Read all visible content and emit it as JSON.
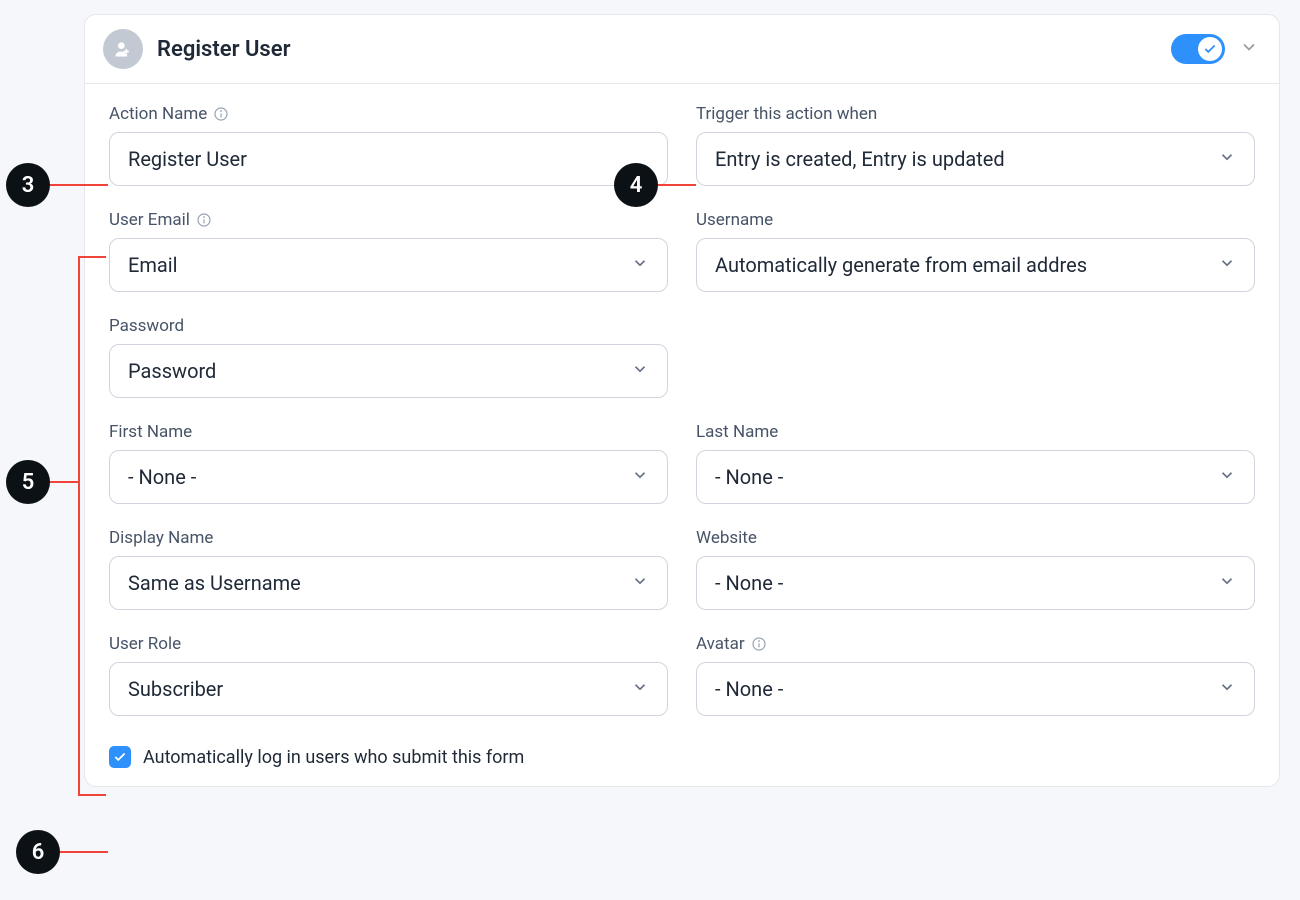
{
  "header": {
    "title": "Register User",
    "toggle_on": true
  },
  "fields": {
    "action_name": {
      "label": "Action Name",
      "value": "Register User",
      "has_info": true
    },
    "trigger": {
      "label": "Trigger this action when",
      "value": "Entry is created, Entry is updated"
    },
    "user_email": {
      "label": "User Email",
      "value": "Email",
      "has_info": true
    },
    "username": {
      "label": "Username",
      "value": "Automatically generate from email addres"
    },
    "password": {
      "label": "Password",
      "value": "Password"
    },
    "first_name": {
      "label": "First Name",
      "value": "- None -"
    },
    "last_name": {
      "label": "Last Name",
      "value": "- None -"
    },
    "display_name": {
      "label": "Display Name",
      "value": "Same as Username"
    },
    "website": {
      "label": "Website",
      "value": "- None -"
    },
    "user_role": {
      "label": "User Role",
      "value": "Subscriber"
    },
    "avatar": {
      "label": "Avatar",
      "value": "- None -",
      "has_info": true
    }
  },
  "auto_login": {
    "label": "Automatically log in users who submit this form",
    "checked": true
  },
  "markers": {
    "m3": "3",
    "m4": "4",
    "m5": "5",
    "m6": "6"
  }
}
